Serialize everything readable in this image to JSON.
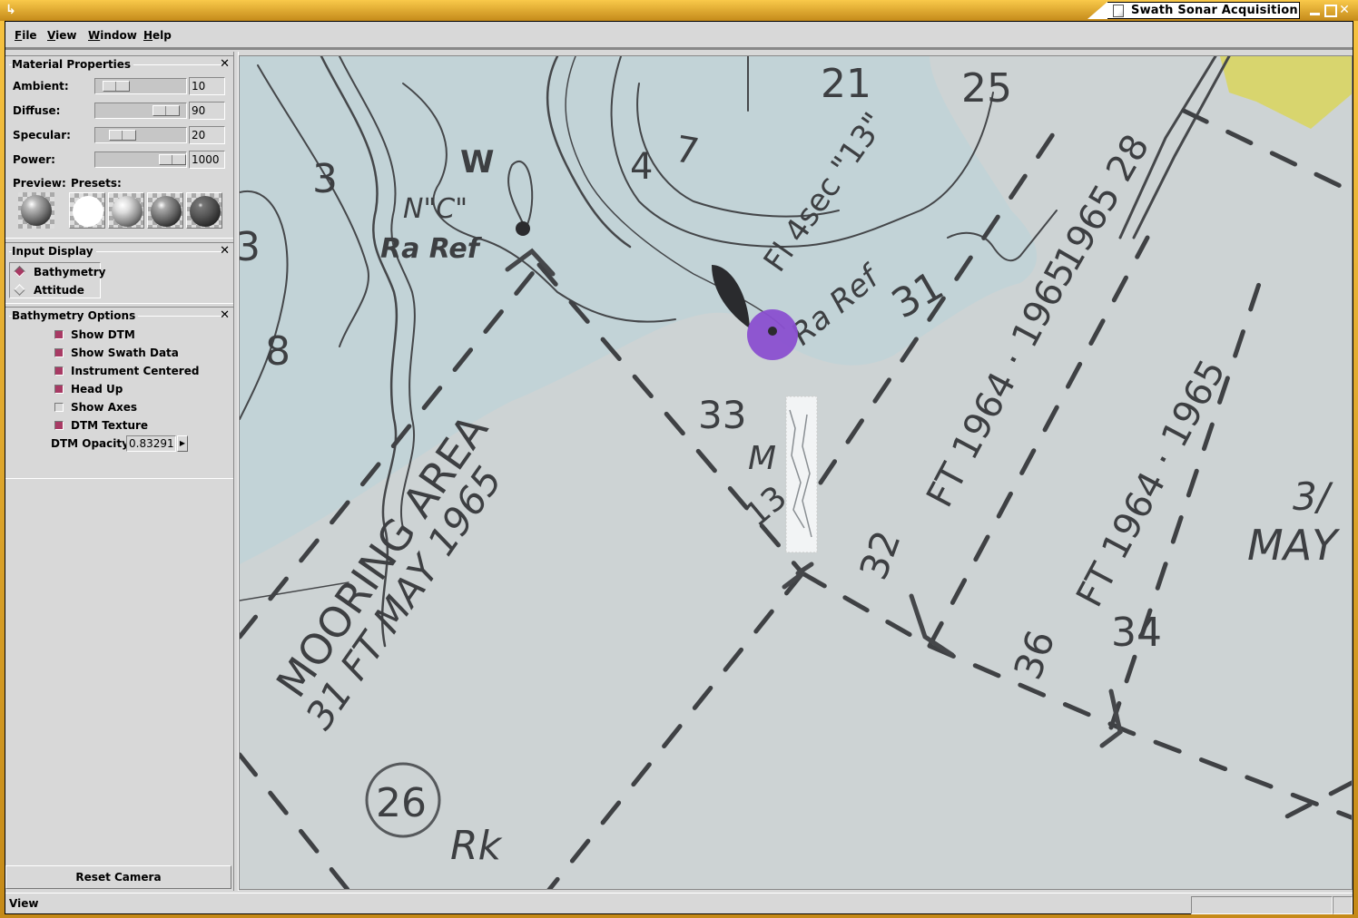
{
  "window": {
    "title": "Swath Sonar Acquisition",
    "app_icon": "↳",
    "controls": {
      "minimize": "minimize-icon",
      "maximize": "maximize-icon",
      "close": "✕"
    }
  },
  "menubar": {
    "items": [
      {
        "label": "File",
        "mnemonic": "F",
        "rest": "ile"
      },
      {
        "label": "View",
        "mnemonic": "V",
        "rest": "iew"
      },
      {
        "label": "Window",
        "mnemonic": "W",
        "rest": "indow"
      },
      {
        "label": "Help",
        "mnemonic": "H",
        "rest": "elp"
      }
    ]
  },
  "material_properties": {
    "title": "Material Properties",
    "close": "✕",
    "sliders": [
      {
        "label": "Ambient:",
        "value": "10",
        "fraction": 0.1
      },
      {
        "label": "Diffuse:",
        "value": "90",
        "fraction": 0.9
      },
      {
        "label": "Specular:",
        "value": "20",
        "fraction": 0.2
      },
      {
        "label": "Power:",
        "value": "1000",
        "fraction": 0.95
      }
    ],
    "preview_label": "Preview:",
    "presets_label": "Presets:",
    "presets": [
      "preset-white",
      "preset-light",
      "preset-medium",
      "preset-dark"
    ]
  },
  "input_display": {
    "title": "Input Display",
    "close": "✕",
    "options": [
      {
        "label": "Bathymetry",
        "selected": true
      },
      {
        "label": "Attitude",
        "selected": false
      }
    ]
  },
  "bathymetry_options": {
    "title": "Bathymetry Options",
    "close": "✕",
    "checks": [
      {
        "label": "Show DTM",
        "checked": true
      },
      {
        "label": "Show Swath Data",
        "checked": true
      },
      {
        "label": "Instrument Centered",
        "checked": true
      },
      {
        "label": "Head Up",
        "checked": true
      },
      {
        "label": "Show Axes",
        "checked": false
      },
      {
        "label": "DTM Texture",
        "checked": true
      }
    ],
    "opacity_label": "DTM Opacity",
    "opacity_value": "0.83291",
    "spin_glyph": "▶"
  },
  "reset_camera_label": "Reset Camera",
  "status": {
    "text": "View"
  },
  "map": {
    "colors": {
      "water": "#c3d4d8",
      "land": "#cdd4d6",
      "ink": "#3d3f42",
      "marker": "#8a4fc9",
      "shore": "#d7d46a"
    },
    "labels": {
      "n21": "21",
      "n25": "25",
      "n3a": "3",
      "n3b": "3",
      "n8": "8",
      "n4": "4",
      "n7": "7",
      "w": "W",
      "nc": "N\"C\"",
      "raref1": "Ra Ref",
      "flsec": "Fl 4sec \"13\"",
      "raref2": "Ra Ref",
      "n31": "31",
      "n33": "33",
      "m": "M",
      "n13": "13",
      "y1965a": "1965 28",
      "ft1964": "FT 1964 · 1965",
      "ft1964b": "FT 1964 · 1965",
      "n32": "32",
      "n36": "36",
      "n34": "34",
      "mooring": "MOORING AREA",
      "ftmay": "31 FT MAY 1965",
      "may2": "3/",
      "may3": "MAY",
      "n26": "26",
      "rk": "Rk"
    }
  }
}
